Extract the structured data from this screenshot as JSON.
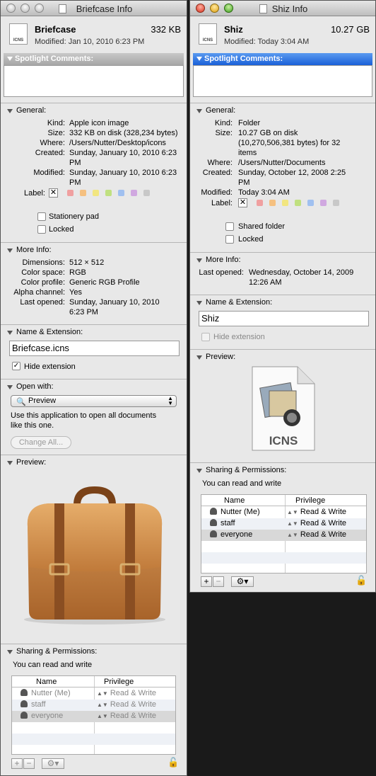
{
  "win1": {
    "title": "Briefcase Info",
    "icon_label": "ICNS",
    "name": "Briefcase",
    "size": "332 KB",
    "modified": "Modified: Jan 10, 2010 6:23 PM",
    "spotlight_label": "Spotlight Comments:",
    "general_label": "General:",
    "general": {
      "kind_k": "Kind:",
      "kind_v": "Apple icon image",
      "size_k": "Size:",
      "size_v": "332 KB on disk (328,234 bytes)",
      "where_k": "Where:",
      "where_v": "/Users/Nutter/Desktop/icons",
      "created_k": "Created:",
      "created_v1": "Sunday, January 10, 2010 6:23",
      "created_v2": "PM",
      "modified_k": "Modified:",
      "modified_v1": "Sunday, January 10, 2010 6:23",
      "modified_v2": "PM",
      "label_k": "Label:",
      "stationery": "Stationery pad",
      "locked": "Locked"
    },
    "moreinfo_label": "More Info:",
    "moreinfo": {
      "dim_k": "Dimensions:",
      "dim_v": "512 × 512",
      "cs_k": "Color space:",
      "cs_v": "RGB",
      "cp_k": "Color profile:",
      "cp_v": "Generic RGB Profile",
      "ac_k": "Alpha channel:",
      "ac_v": "Yes",
      "lo_k": "Last opened:",
      "lo_v1": "Sunday, January 10, 2010",
      "lo_v2": "6:23 PM"
    },
    "nameext_label": "Name & Extension:",
    "filename": "Briefcase.icns",
    "hide_ext": "Hide extension",
    "openwith_label": "Open with:",
    "app": "Preview",
    "openwith_text1": "Use this application to open all documents",
    "openwith_text2": "like this one.",
    "change_all": "Change All...",
    "preview_label": "Preview:",
    "sharing_label": "Sharing & Permissions:",
    "access": "You can read and write",
    "col_name": "Name",
    "col_priv": "Privilege",
    "rows": [
      {
        "name": "Nutter (Me)",
        "priv": "Read & Write"
      },
      {
        "name": "staff",
        "priv": "Read & Write"
      },
      {
        "name": "everyone",
        "priv": "Read & Write"
      }
    ]
  },
  "win2": {
    "title": "Shiz Info",
    "icon_label": "ICNS",
    "name": "Shiz",
    "size": "10.27 GB",
    "modified": "Modified: Today 3:04 AM",
    "spotlight_label": "Spotlight Comments:",
    "general_label": "General:",
    "general": {
      "kind_k": "Kind:",
      "kind_v": "Folder",
      "size_k": "Size:",
      "size_v1": "10.27 GB on disk",
      "size_v2": "(10,270,506,381 bytes) for 32",
      "size_v3": "items",
      "where_k": "Where:",
      "where_v": "/Users/Nutter/Documents",
      "created_k": "Created:",
      "created_v1": "Sunday, October 12, 2008 2:25",
      "created_v2": "PM",
      "modified_k": "Modified:",
      "modified_v": "Today 3:04 AM",
      "label_k": "Label:",
      "shared": "Shared folder",
      "locked": "Locked"
    },
    "moreinfo_label": "More Info:",
    "lo_k": "Last opened:",
    "lo_v1": "Wednesday, October 14, 2009",
    "lo_v2": "12:26 AM",
    "nameext_label": "Name & Extension:",
    "filename": "Shiz",
    "hide_ext": "Hide extension",
    "preview_label": "Preview:",
    "preview_icon_text": "ICNS",
    "sharing_label": "Sharing & Permissions:",
    "access": "You can read and write",
    "col_name": "Name",
    "col_priv": "Privilege",
    "rows": [
      {
        "name": "Nutter (Me)",
        "priv": "Read & Write"
      },
      {
        "name": "staff",
        "priv": "Read & Write"
      },
      {
        "name": "everyone",
        "priv": "Read & Write"
      }
    ]
  },
  "label_colors": [
    "#f0a0a0",
    "#f5c080",
    "#f2e680",
    "#c0e080",
    "#a0c0f0",
    "#d0a8e0",
    "#c8c8c8"
  ]
}
